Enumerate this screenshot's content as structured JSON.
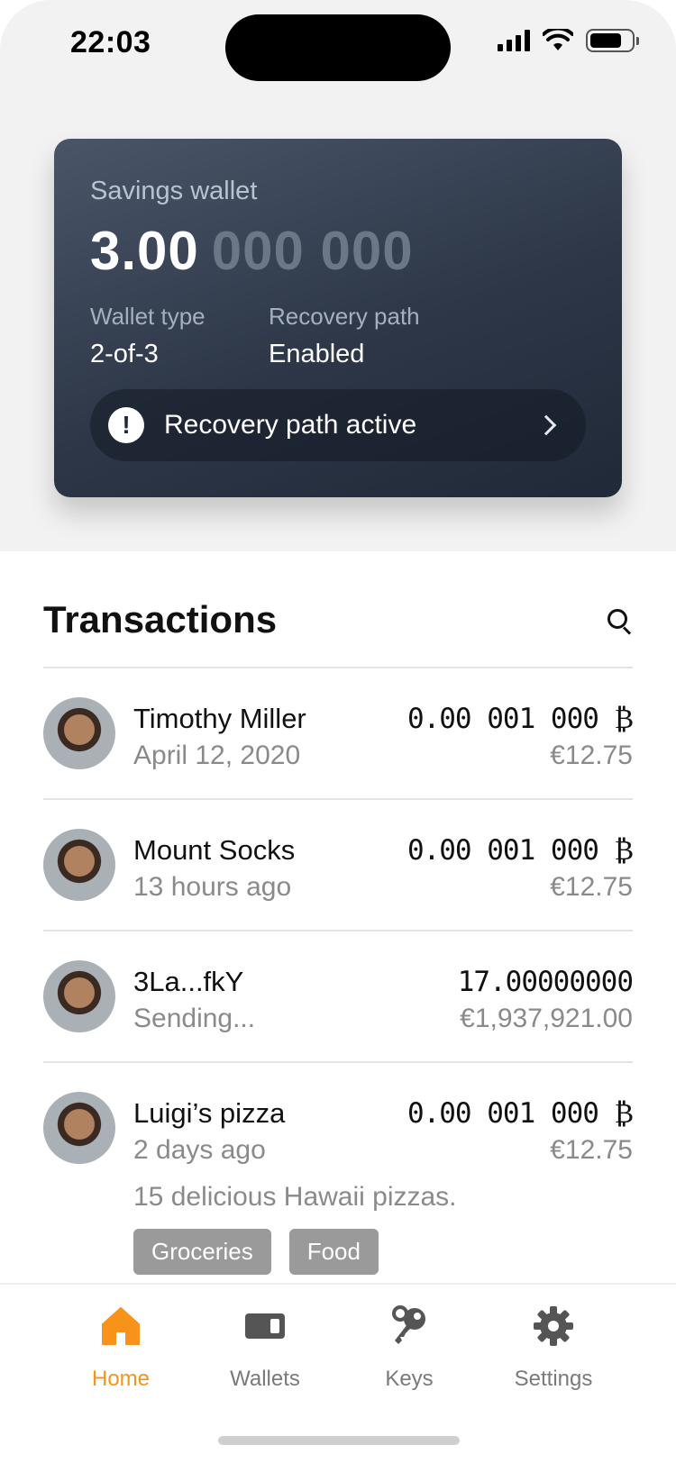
{
  "status_bar": {
    "time": "22:03"
  },
  "wallet": {
    "name": "Savings wallet",
    "balance_main": "3.00",
    "balance_dim": "000 000",
    "type_label": "Wallet type",
    "type_value": "2-of-3",
    "recovery_label": "Recovery path",
    "recovery_value": "Enabled",
    "alert_text": "Recovery path active"
  },
  "transactions": {
    "title": "Transactions",
    "items": [
      {
        "name": "Timothy Miller",
        "sub": "April 12, 2020",
        "btc": "0.00 001 000 ₿",
        "eur": "€12.75"
      },
      {
        "name": "Mount Socks",
        "sub": "13 hours ago",
        "btc": "0.00 001 000 ₿",
        "eur": "€12.75"
      },
      {
        "name": "3La...fkY",
        "sub": "Sending...",
        "btc": "17.00000000",
        "eur": "€1,937,921.00"
      },
      {
        "name": "Luigi’s pizza",
        "sub": "2 days ago",
        "btc": "0.00 001 000 ₿",
        "eur": "€12.75",
        "note": "15 delicious Hawaii pizzas.",
        "tags": [
          "Groceries",
          "Food"
        ]
      }
    ]
  },
  "tabs": [
    {
      "label": "Home",
      "icon": "home-icon",
      "active": true
    },
    {
      "label": "Wallets",
      "icon": "wallet-icon",
      "active": false
    },
    {
      "label": "Keys",
      "icon": "key-icon",
      "active": false
    },
    {
      "label": "Settings",
      "icon": "gear-icon",
      "active": false
    }
  ],
  "colors": {
    "accent": "#f7931a",
    "card_top": "#4a5568",
    "card_bottom": "#1f2937"
  }
}
